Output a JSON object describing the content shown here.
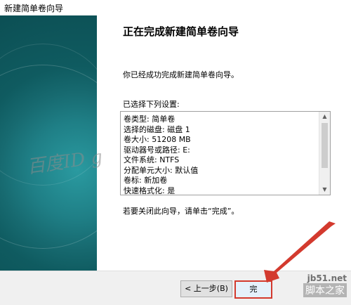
{
  "window": {
    "title": "新建简单卷向导"
  },
  "page": {
    "heading": "正在完成新建简单卷向导",
    "success_text": "你已经成功完成新建简单卷向导。",
    "settings_label": "已选择下列设置:",
    "settings": [
      "卷类型: 简单卷",
      "选择的磁盘: 磁盘 1",
      "卷大小: 51208 MB",
      "驱动器号或路径: E:",
      "文件系统: NTFS",
      "分配单元大小: 默认值",
      "卷标: 新加卷",
      "快速格式化: 是"
    ],
    "finish_hint": "若要关闭此向导，请单击“完成”。"
  },
  "buttons": {
    "back": "< 上一步(B)",
    "finish": "完"
  },
  "watermarks": {
    "baidu": "百度ID g",
    "site_url": "jb51.net",
    "site_name": "脚本之家"
  },
  "colors": {
    "panel_teal": "#176a70",
    "highlight": "#d33a2e"
  },
  "icons": {
    "scroll_up": "▲",
    "scroll_down": "▼"
  }
}
